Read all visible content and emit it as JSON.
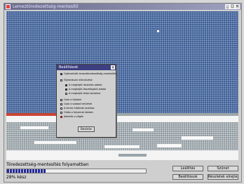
{
  "window": {
    "title": "Lemeztöredezettség-mentesítő",
    "icon": "app-icon",
    "controls": [
      "minimize",
      "maximize",
      "close"
    ]
  },
  "dialog": {
    "title": "Beállítások",
    "options": [
      {
        "label": "Optimalizált lemeztöredezettség-mentesítés",
        "checked": true
      },
      {
        "label": "Fájlrendszer ellenőrzése",
        "checked": false
      },
      {
        "label": "A meghajtó részletes adatai",
        "checked": true
      },
      {
        "label": "A meghajtó összefoglaló adatai",
        "checked": true
      },
      {
        "label": "A meghajtó teljes tartalma",
        "checked": false
      },
      {
        "label": "Csak a fájlokat",
        "checked": false
      },
      {
        "label": "Csak a szabad területet",
        "checked": false
      },
      {
        "label": "A lemez hibáinak javítása",
        "checked": false
      },
      {
        "label": "Oldás a folyamat közben",
        "checked": false
      },
      {
        "label": "Jelentés a végén",
        "checked": true
      }
    ],
    "ok_label": "Bezárás"
  },
  "status": {
    "text": "Töredezettség-mentesítés folyamatban",
    "progress": 0.28,
    "percent_text": "28% kész"
  },
  "buttons": {
    "start": "Leállítás",
    "stop": "Szünet",
    "settings": "Beállítások",
    "legend": "Részletek elrejtése"
  },
  "colors": {
    "map_blue": "#3d5f97",
    "map_grey": "#8f9aa0",
    "progress": "#24289a"
  }
}
